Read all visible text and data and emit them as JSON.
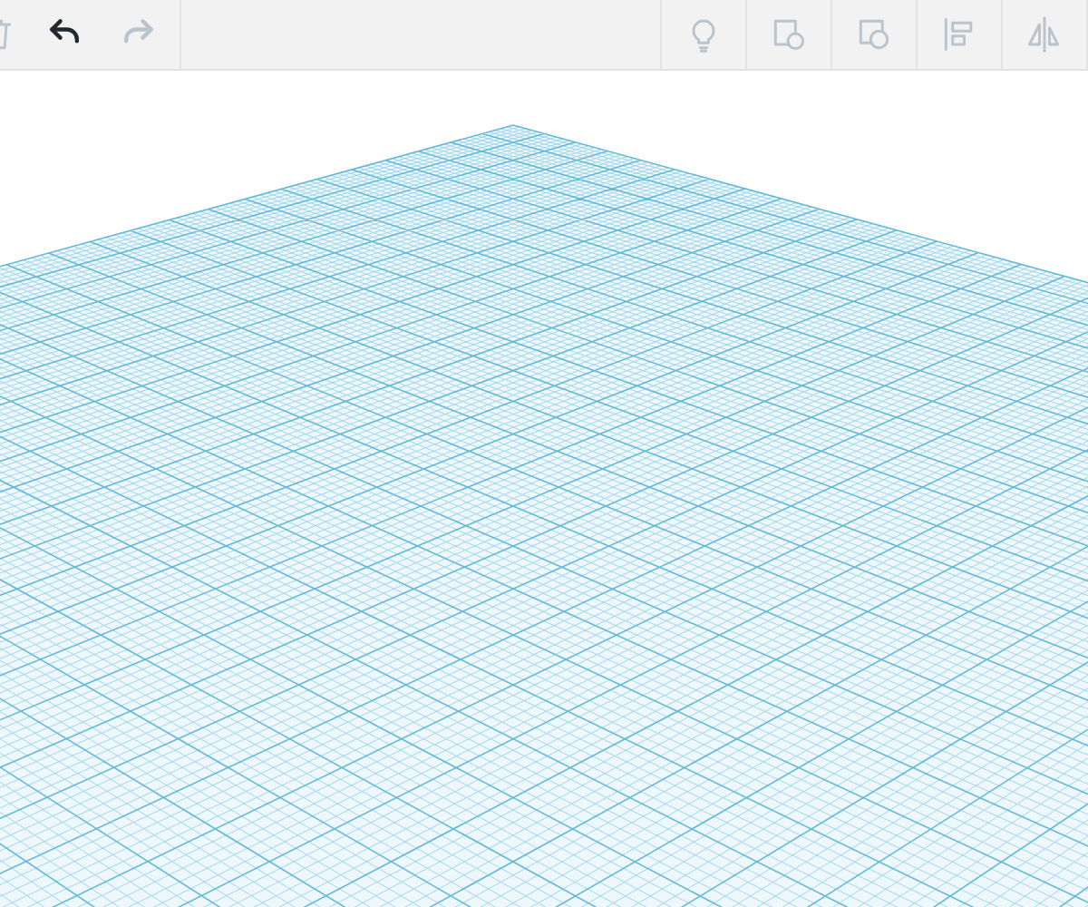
{
  "toolbar": {
    "left_tools": [
      {
        "kind": "trash",
        "disabled": true
      },
      {
        "kind": "undo",
        "disabled": false
      },
      {
        "kind": "redo",
        "disabled": true
      }
    ],
    "right_tools": [
      {
        "kind": "bulb",
        "disabled": true
      },
      {
        "kind": "group",
        "disabled": true
      },
      {
        "kind": "ungroup",
        "disabled": true
      },
      {
        "kind": "align",
        "disabled": true
      },
      {
        "kind": "mirror",
        "disabled": true
      }
    ]
  }
}
